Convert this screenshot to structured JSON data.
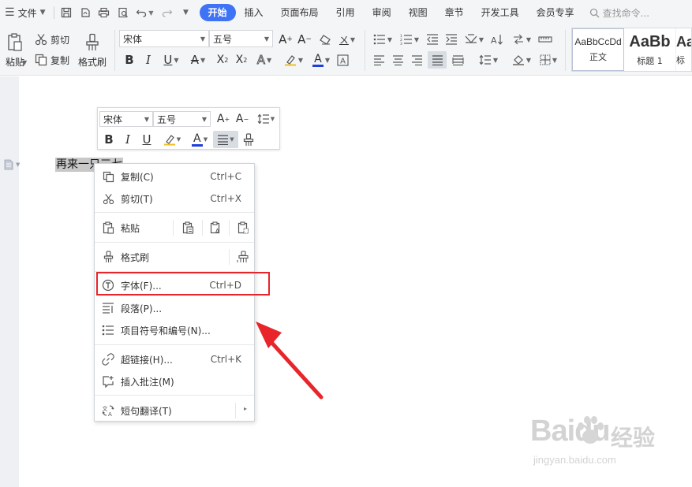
{
  "menubar": {
    "file_label": "文件",
    "tabs": [
      {
        "label": "开始",
        "active": true
      },
      {
        "label": "插入"
      },
      {
        "label": "页面布局"
      },
      {
        "label": "引用"
      },
      {
        "label": "审阅"
      },
      {
        "label": "视图"
      },
      {
        "label": "章节"
      },
      {
        "label": "开发工具"
      },
      {
        "label": "会员专享"
      }
    ],
    "search_placeholder": "查找命令..."
  },
  "ribbon": {
    "paste_label": "粘贴",
    "cut_label": "剪切",
    "copy_label": "复制",
    "format_painter_label": "格式刷",
    "font_name": "宋体",
    "font_size": "五号",
    "styles": [
      {
        "sample": "AaBbCcDd",
        "name": "正文"
      },
      {
        "sample": "AaBb",
        "name": "标题 1"
      },
      {
        "sample": "Aa",
        "name": "标"
      }
    ]
  },
  "mini_toolbar": {
    "font_name": "宋体",
    "font_size": "五号"
  },
  "document": {
    "selected_text": "再来一只三七"
  },
  "context_menu": {
    "copy": {
      "label": "复制(C)",
      "shortcut": "Ctrl+C"
    },
    "cut": {
      "label": "剪切(T)",
      "shortcut": "Ctrl+X"
    },
    "paste": {
      "label": "粘贴"
    },
    "format_painter": {
      "label": "格式刷"
    },
    "font": {
      "label": "字体(F)...",
      "shortcut": "Ctrl+D"
    },
    "paragraph": {
      "label": "段落(P)..."
    },
    "bullets": {
      "label": "项目符号和编号(N)..."
    },
    "hyperlink": {
      "label": "超链接(H)...",
      "shortcut": "Ctrl+K"
    },
    "comment": {
      "label": "插入批注(M)"
    },
    "translate": {
      "label": "短句翻译(T)"
    }
  },
  "watermark": {
    "brand": "Baidu",
    "cn": "经验",
    "url": "jingyan.baidu.com"
  },
  "colors": {
    "accent": "#3f73f5",
    "highlight": "#e8252a",
    "font_color_bar": "#1f3fdb"
  }
}
